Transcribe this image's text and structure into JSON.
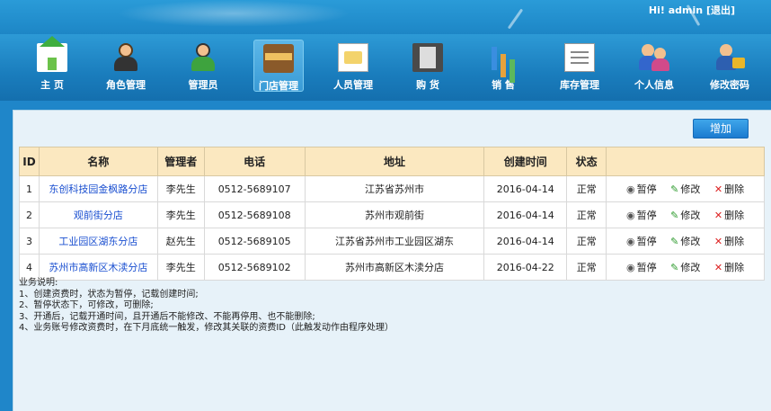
{
  "header": {
    "greeting": "Hi! admin",
    "logout": "[退出]"
  },
  "nav": [
    {
      "label": "主 页",
      "icon": "home-icon"
    },
    {
      "label": "角色管理",
      "icon": "role-icon"
    },
    {
      "label": "管理员",
      "icon": "admin-icon"
    },
    {
      "label": "门店管理",
      "icon": "store-icon",
      "active": true
    },
    {
      "label": "人员管理",
      "icon": "staff-icon"
    },
    {
      "label": "购 货",
      "icon": "purchase-icon"
    },
    {
      "label": "销 售",
      "icon": "sales-icon"
    },
    {
      "label": "库存管理",
      "icon": "inventory-icon"
    },
    {
      "label": "个人信息",
      "icon": "profile-icon"
    },
    {
      "label": "修改密码",
      "icon": "password-icon"
    }
  ],
  "toolbar": {
    "add_label": "增加"
  },
  "table": {
    "columns": [
      "ID",
      "名称",
      "管理者",
      "电话",
      "地址",
      "创建时间",
      "状态",
      ""
    ],
    "rows": [
      {
        "id": "1",
        "name": "东创科技园金枫路分店",
        "manager": "李先生",
        "phone": "0512-5689107",
        "address": "江苏省苏州市",
        "created": "2016-04-14",
        "status": "正常"
      },
      {
        "id": "2",
        "name": "观前街分店",
        "manager": "李先生",
        "phone": "0512-5689108",
        "address": "苏州市观前街",
        "created": "2016-04-14",
        "status": "正常"
      },
      {
        "id": "3",
        "name": "工业园区湖东分店",
        "manager": "赵先生",
        "phone": "0512-5689105",
        "address": "江苏省苏州市工业园区湖东",
        "created": "2016-04-14",
        "status": "正常"
      },
      {
        "id": "4",
        "name": "苏州市高新区木渎分店",
        "manager": "李先生",
        "phone": "0512-5689102",
        "address": "苏州市高新区木渎分店",
        "created": "2016-04-22",
        "status": "正常"
      }
    ],
    "actions": {
      "pause": "暂停",
      "edit": "修改",
      "delete": "删除"
    }
  },
  "notes": {
    "title": "业务说明:",
    "lines": [
      "1、创建资费时，状态为暂停，记载创建时间;",
      "2、暂停状态下，可修改，可删除;",
      "3、开通后，记载开通时间，且开通后不能修改、不能再停用、也不能删除;",
      "4、业务账号修改资费时，在下月底统一触发，修改其关联的资费ID（此触发动作由程序处理）"
    ]
  }
}
